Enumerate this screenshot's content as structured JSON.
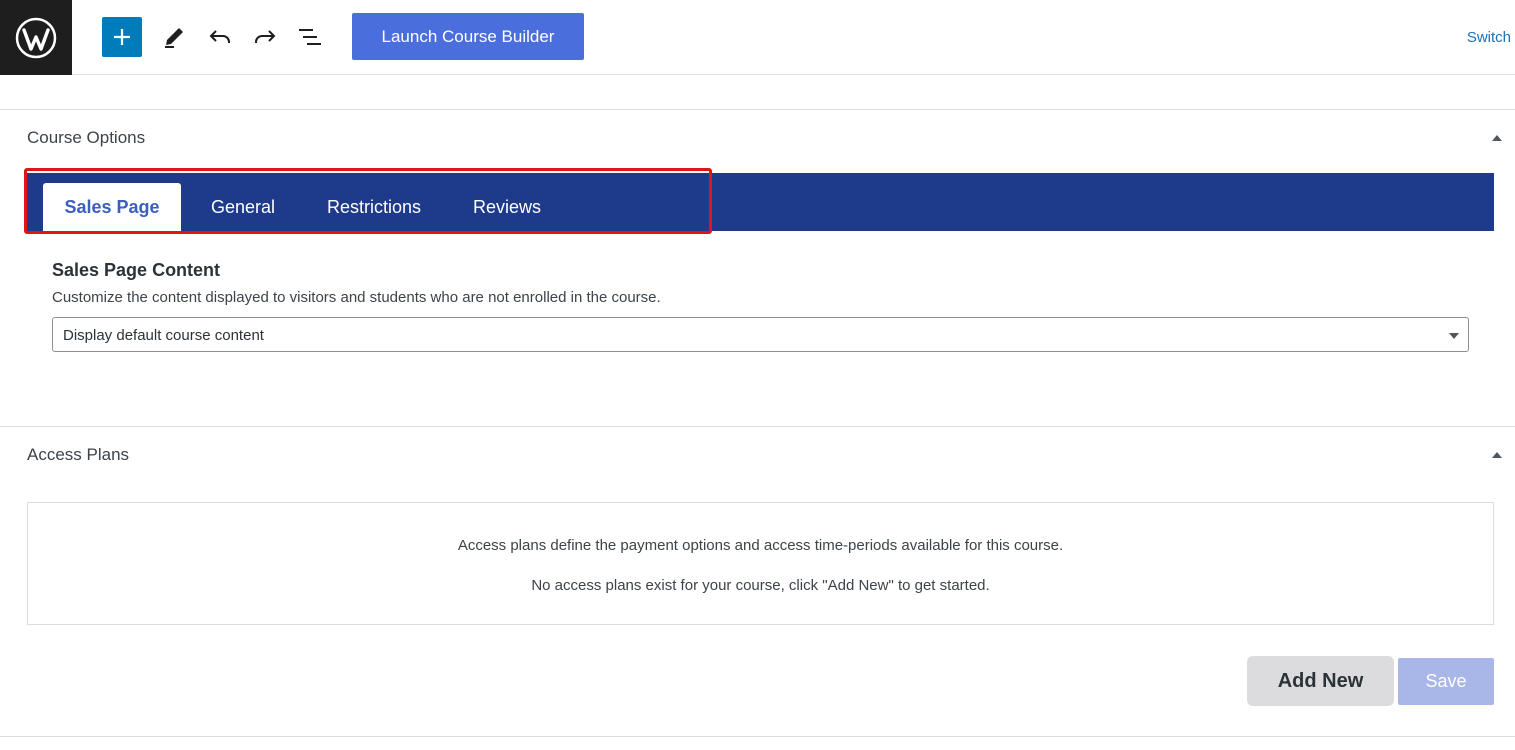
{
  "toolbar": {
    "logo_icon": "wordpress-logo",
    "add_icon": "plus-icon",
    "tools_icon": "pencil-icon",
    "undo_icon": "undo-icon",
    "redo_icon": "redo-icon",
    "outline_icon": "list-view-icon",
    "launch_label": "Launch Course Builder",
    "switch_label": "Switch"
  },
  "course_options": {
    "title": "Course Options",
    "tabs": [
      {
        "label": "Sales Page",
        "active": true
      },
      {
        "label": "General",
        "active": false
      },
      {
        "label": "Restrictions",
        "active": false
      },
      {
        "label": "Reviews",
        "active": false
      }
    ],
    "field": {
      "heading": "Sales Page Content",
      "description": "Customize the content displayed to visitors and students who are not enrolled in the course.",
      "selected": "Display default course content"
    }
  },
  "access_plans": {
    "title": "Access Plans",
    "line1": "Access plans define the payment options and access time-periods available for this course.",
    "line2": "No access plans exist for your course, click \"Add New\" to get started.",
    "add_new_label": "Add New",
    "save_label": "Save"
  },
  "colors": {
    "tab_bar": "#1e3a8a",
    "accent": "#4a6edb",
    "highlight": "#e0141c",
    "wp_blue": "#007cba"
  }
}
